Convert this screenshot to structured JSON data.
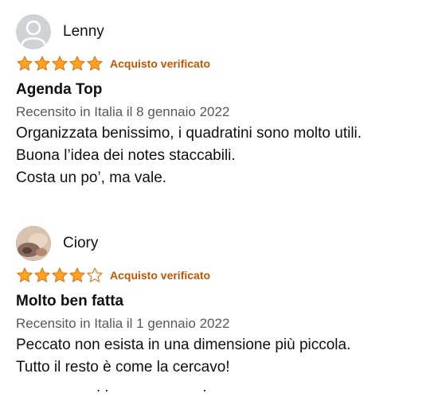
{
  "reviews": [
    {
      "author": "Lenny",
      "avatar": "generic-user-icon",
      "rating": 5,
      "max_rating": 5,
      "verified_label": "Acquisto verificato",
      "title": "Agenda Top",
      "date_line": "Recensito in Italia il 8 gennaio 2022",
      "body_lines": [
        "Organizzata benissimo, i quadratini sono molto utili.",
        "Buona l’idea dei notes staccabili.",
        "Costa un po’, ma vale."
      ]
    },
    {
      "author": "Ciory",
      "avatar": "user-photo",
      "rating": 4,
      "max_rating": 5,
      "verified_label": "Acquisto verificato",
      "title": "Molto ben fatta",
      "date_line": "Recensito in Italia il 1 gennaio 2022",
      "body_lines": [
        "Peccato non esista in una dimensione più piccola.",
        "Tutto il resto è come la cercavo!"
      ]
    }
  ],
  "colors": {
    "star_fill": "#ffa41c",
    "star_stroke": "#de7921",
    "verified": "#c45500",
    "date": "#565959",
    "text": "#0f1111"
  }
}
